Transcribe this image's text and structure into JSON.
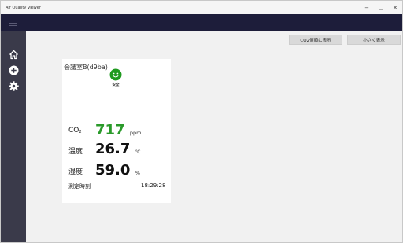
{
  "window": {
    "title": "Air Quality Viewer",
    "minimize_glyph": "−",
    "maximize_glyph": "□",
    "close_glyph": "✕"
  },
  "toolbar": {
    "co2_button_label": "CO2値順に表示",
    "small_button_label": "小さく表示"
  },
  "sidebar": {
    "items": [
      {
        "icon": "home-icon"
      },
      {
        "icon": "add-circle-icon"
      },
      {
        "icon": "gear-icon"
      }
    ]
  },
  "card": {
    "room_name": "会議室B(d9ba)",
    "status_icon": "smiley-face-icon",
    "status_label": "安全",
    "co2_label_main": "CO",
    "co2_label_sub": "2",
    "co2_value": "717",
    "co2_unit": "ppm",
    "temp_label": "温度",
    "temp_value": "26.7",
    "temp_unit": "℃",
    "humidity_label": "湿度",
    "humidity_value": "59.0",
    "humidity_unit": "%",
    "time_label": "測定時刻",
    "time_value": "18:29:28"
  },
  "colors": {
    "appbar": "#1d1d3a",
    "sidebar": "#3a3a4a",
    "safe_green": "#2a9a2a",
    "face_green": "#1f9a1f"
  }
}
